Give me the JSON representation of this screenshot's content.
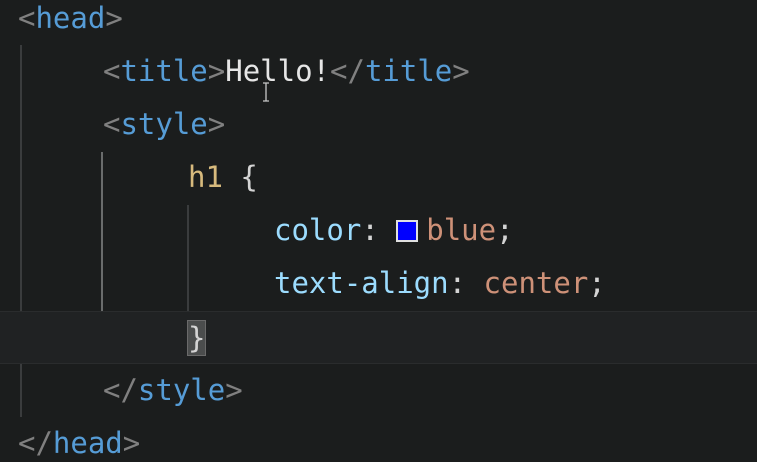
{
  "colors": {
    "background": "#1b1d1d",
    "tag": "#569cd6",
    "punctuation": "#808080",
    "selector": "#d7ba7d",
    "property": "#9cdcfe",
    "value": "#ce9178",
    "swatch": "#0000ff"
  },
  "code": {
    "l1": {
      "open": "<",
      "tag": "head",
      "close": ">"
    },
    "l2": {
      "open": "<",
      "tag": "title",
      "close": ">",
      "text": "Hello!",
      "end_open": "</",
      "end_tag": "title",
      "end_close": ">"
    },
    "l3": {
      "open": "<",
      "tag": "style",
      "close": ">"
    },
    "l4": {
      "selector": "h1",
      "brace": " {"
    },
    "l5": {
      "property": "color",
      "colon": ": ",
      "value": "blue",
      "semi": ";"
    },
    "l6": {
      "property": "text-align",
      "colon": ": ",
      "value": "center",
      "semi": ";"
    },
    "l7": {
      "brace": "}"
    },
    "l8": {
      "open": "</",
      "tag": "style",
      "close": ">"
    },
    "l9": {
      "open": "</",
      "tag": "head",
      "close": ">"
    }
  },
  "icons": {
    "text_cursor": "i-beam-cursor-icon",
    "color_swatch": "color-swatch-icon"
  }
}
